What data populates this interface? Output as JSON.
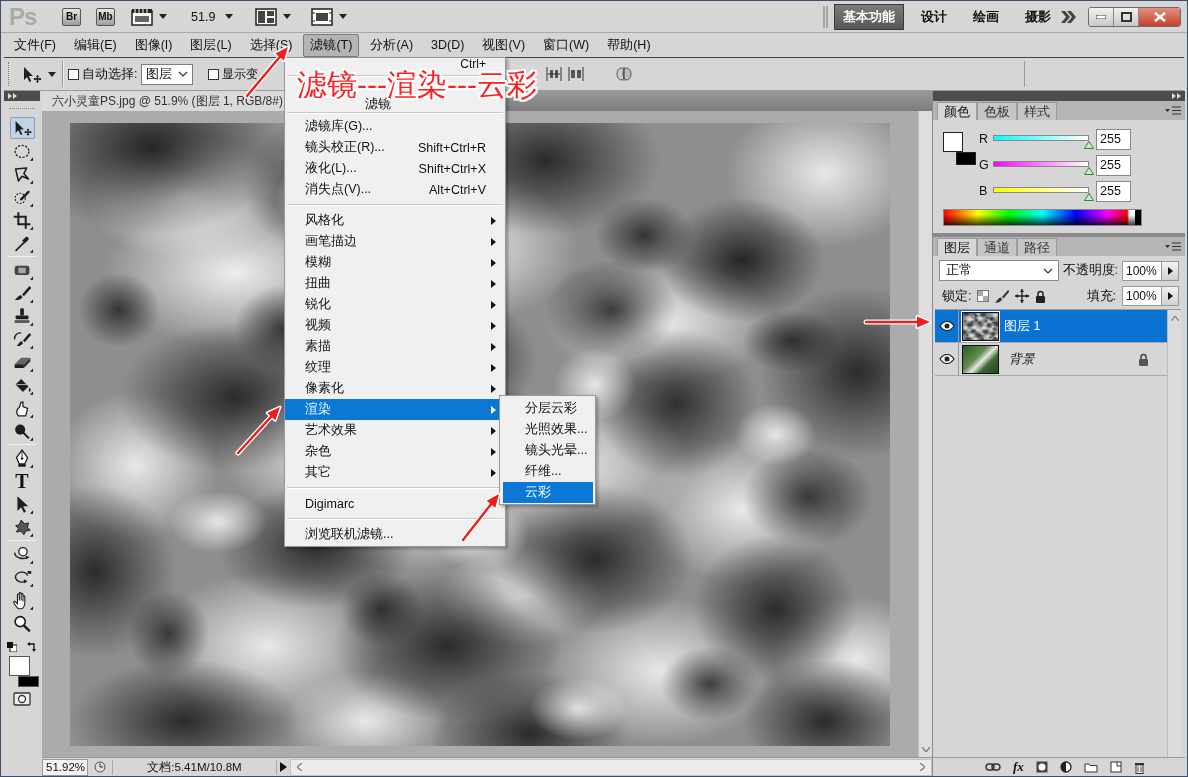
{
  "title_bar": {
    "logo": "Ps",
    "bridge": "Br",
    "mini_bridge": "Mb",
    "zoom": "51.9",
    "workspaces": [
      {
        "label": "基本功能",
        "selected": true
      },
      {
        "label": "设计",
        "selected": false
      },
      {
        "label": "绘画",
        "selected": false
      },
      {
        "label": "摄影",
        "selected": false
      }
    ]
  },
  "menu_bar": [
    {
      "label": "文件(F)",
      "selected": false
    },
    {
      "label": "编辑(E)",
      "selected": false
    },
    {
      "label": "图像(I)",
      "selected": false
    },
    {
      "label": "图层(L)",
      "selected": false
    },
    {
      "label": "选择(S)",
      "selected": false
    },
    {
      "label": "滤镜(T)",
      "selected": true
    },
    {
      "label": "分析(A)",
      "selected": false
    },
    {
      "label": "3D(D)",
      "selected": false
    },
    {
      "label": "视图(V)",
      "selected": false
    },
    {
      "label": "窗口(W)",
      "selected": false
    },
    {
      "label": "帮助(H)",
      "selected": false
    }
  ],
  "options_bar": {
    "auto_select": {
      "label": "自动选择:",
      "checked": false
    },
    "auto_select_target": "图层",
    "show_transform": {
      "label": "显示变",
      "checked": false
    }
  },
  "toolbox": {
    "tool_groups": [
      [
        {
          "kind": "move",
          "selected": true
        },
        {
          "kind": "marquee",
          "selected": false
        },
        {
          "kind": "lasso",
          "selected": false
        },
        {
          "kind": "quick_select",
          "selected": false
        },
        {
          "kind": "crop",
          "selected": false
        },
        {
          "kind": "eyedropper",
          "selected": false
        }
      ],
      [
        {
          "kind": "healing",
          "selected": false
        },
        {
          "kind": "brush",
          "selected": false
        },
        {
          "kind": "stamp",
          "selected": false
        },
        {
          "kind": "history_brush",
          "selected": false
        },
        {
          "kind": "eraser",
          "selected": false
        },
        {
          "kind": "bucket",
          "selected": false
        },
        {
          "kind": "smudge",
          "selected": false
        },
        {
          "kind": "dodge",
          "selected": false
        }
      ],
      [
        {
          "kind": "pen",
          "selected": false
        },
        {
          "kind": "type",
          "label": "T",
          "selected": false
        },
        {
          "kind": "path_select",
          "selected": false
        },
        {
          "kind": "shape",
          "selected": false
        }
      ],
      [
        {
          "kind": "rotate_3d",
          "selected": false
        },
        {
          "kind": "orbit_3d",
          "selected": false
        },
        {
          "kind": "hand",
          "selected": false
        },
        {
          "kind": "zoom",
          "selected": false
        }
      ]
    ],
    "swatches": [
      {
        "kind": "foreground",
        "color": "#ffffff"
      },
      {
        "kind": "background",
        "color": "#000000"
      }
    ]
  },
  "document": {
    "tab": "六小灵童PS.jpg @ 51.9% (图层 1, RGB/8#)"
  },
  "status_bar": {
    "zoom": "51.92%",
    "doc_size": "文档:5.41M/10.8M"
  },
  "color_panel": {
    "tabs": [
      {
        "label": "颜色",
        "selected": true
      },
      {
        "label": "色板",
        "selected": false
      },
      {
        "label": "样式",
        "selected": false
      }
    ],
    "swatches": [
      {
        "kind": "foreground",
        "color": "#ffffff"
      },
      {
        "kind": "background",
        "color": "#000000"
      }
    ],
    "channels": [
      {
        "name": "R",
        "kind": "red",
        "level": 1,
        "value": "255"
      },
      {
        "name": "G",
        "kind": "green",
        "level": 1,
        "value": "255"
      },
      {
        "name": "B",
        "kind": "blue",
        "level": 1,
        "value": "255"
      }
    ]
  },
  "layers_panel": {
    "tabs": [
      {
        "label": "图层",
        "selected": true
      },
      {
        "label": "通道",
        "selected": false
      },
      {
        "label": "路径",
        "selected": false
      }
    ],
    "blend_mode": "正常",
    "opacity_label": "不透明度:",
    "opacity": "100%",
    "lock_label": "锁定:",
    "fill_label": "填充:",
    "fill": "100%",
    "layers": [
      {
        "name": "图层 1",
        "kind": "layer",
        "selected": true,
        "visible": true,
        "locked": false
      },
      {
        "name": "背景",
        "kind": "background",
        "selected": false,
        "visible": true,
        "locked": true
      }
    ],
    "effects_button": "fx"
  },
  "filter_menu": {
    "sections": [
      [
        {
          "kind": "covered",
          "shortcut": "Ctrl+",
          "selected": false
        }
      ],
      [
        {
          "kind": "covered",
          "label": "滤镜",
          "selected": false
        }
      ],
      [
        {
          "kind": "command",
          "label": "滤镜库(G)...",
          "selected": false
        },
        {
          "kind": "command",
          "label": "镜头校正(R)...",
          "shortcut": "Shift+Ctrl+R",
          "selected": false
        },
        {
          "kind": "command",
          "label": "液化(L)...",
          "shortcut": "Shift+Ctrl+X",
          "selected": false
        },
        {
          "kind": "command",
          "label": "消失点(V)...",
          "shortcut": "Alt+Ctrl+V",
          "selected": false
        }
      ],
      [
        {
          "kind": "submenu",
          "label": "风格化",
          "selected": false
        },
        {
          "kind": "submenu",
          "label": "画笔描边",
          "selected": false
        },
        {
          "kind": "submenu",
          "label": "模糊",
          "selected": false
        },
        {
          "kind": "submenu",
          "label": "扭曲",
          "selected": false
        },
        {
          "kind": "submenu",
          "label": "锐化",
          "selected": false
        },
        {
          "kind": "submenu",
          "label": "视频",
          "selected": false
        },
        {
          "kind": "submenu",
          "label": "素描",
          "selected": false
        },
        {
          "kind": "submenu",
          "label": "纹理",
          "selected": false
        },
        {
          "kind": "submenu",
          "label": "像素化",
          "selected": false
        },
        {
          "kind": "submenu",
          "label": "渲染",
          "selected": true
        },
        {
          "kind": "submenu",
          "label": "艺术效果",
          "selected": false
        },
        {
          "kind": "submenu",
          "label": "杂色",
          "selected": false
        },
        {
          "kind": "submenu",
          "label": "其它",
          "selected": false
        }
      ],
      [
        {
          "kind": "command",
          "label": "Digimarc",
          "selected": false
        }
      ],
      [
        {
          "kind": "command",
          "label": "浏览联机滤镜...",
          "selected": false
        }
      ]
    ]
  },
  "render_submenu": [
    {
      "label": "分层云彩",
      "selected": false
    },
    {
      "label": "光照效果...",
      "selected": false
    },
    {
      "label": "镜头光晕...",
      "selected": false
    },
    {
      "label": "纤维...",
      "selected": false
    },
    {
      "label": "云彩",
      "selected": true
    }
  ],
  "annotation": {
    "text": "滤镜---渲染---云彩"
  }
}
